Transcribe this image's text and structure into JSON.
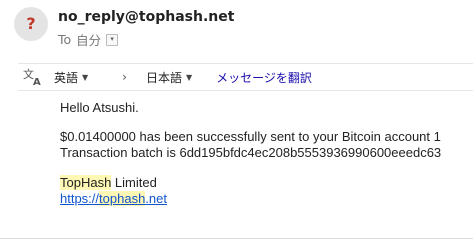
{
  "header": {
    "avatar_glyph": "?",
    "sender": "no_reply@tophash.net",
    "to_label": "To",
    "recipient": "自分",
    "dropdown_glyph": "▾"
  },
  "translate_bar": {
    "icon": "translate-icon",
    "source_language": "英語",
    "arrow": "›",
    "target_language": "日本語",
    "action_link": "メッセージを翻訳"
  },
  "message": {
    "greeting": "Hello Atsushi.",
    "line1": "$0.01400000 has been successfully sent to your Bitcoin account 1",
    "line2": "Transaction batch is 6dd195bfdc4ec208b5553936990600eeedc63",
    "signature": {
      "company_highlight": "TopHash",
      "company_rest": " Limited",
      "link_prefix": "https://",
      "link_highlight": "tophash",
      "link_suffix": ".net"
    }
  },
  "colors": {
    "avatar_bg": "#e4e4e4",
    "avatar_glyph": "#c0392b",
    "link": "#1155cc",
    "translate_link": "#1a0dab",
    "highlight": "#fff8b5"
  }
}
